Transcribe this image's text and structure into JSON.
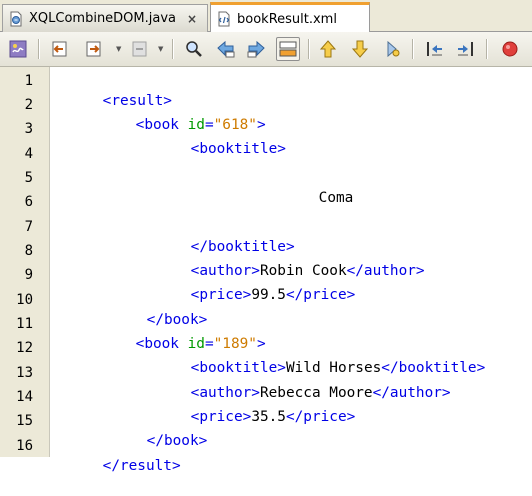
{
  "tabs": [
    {
      "label": "XQLCombineDOM.java",
      "icon": "java-file-icon",
      "close": "×",
      "active": false
    },
    {
      "label": "bookResult.xml",
      "icon": "xml-file-icon",
      "active": true
    }
  ],
  "toolbar": {
    "buttons": [
      "source-history-icon",
      "back-icon",
      "forward-icon",
      "disabled-icon",
      "find-icon",
      "find-previous-icon",
      "find-next-icon",
      "toggle-highlight-icon",
      "previous-bookmark-icon",
      "next-bookmark-icon",
      "toggle-bookmark-icon",
      "shift-left-icon",
      "shift-right-icon",
      "stop-macro-icon"
    ]
  },
  "editor": {
    "line_numbers": [
      "1",
      "2",
      "3",
      "4",
      "5",
      "6",
      "7",
      "8",
      "9",
      "10",
      "11",
      "12",
      "13",
      "14",
      "15",
      "16"
    ],
    "lines": [
      [
        {
          "t": "<result>",
          "c": "tag"
        }
      ],
      [
        {
          "t": "<book ",
          "c": "tag"
        },
        {
          "t": "id",
          "c": "attr"
        },
        {
          "t": "=",
          "c": "tag"
        },
        {
          "t": "\"618\"",
          "c": "val"
        },
        {
          "t": ">",
          "c": "tag"
        }
      ],
      [
        {
          "t": "<booktitle>",
          "c": "tag"
        }
      ],
      [],
      [
        {
          "t": "Coma",
          "c": "txt"
        }
      ],
      [],
      [
        {
          "t": "</booktitle>",
          "c": "tag"
        }
      ],
      [
        {
          "t": "<author>",
          "c": "tag"
        },
        {
          "t": "Robin Cook",
          "c": "txt"
        },
        {
          "t": "</author>",
          "c": "tag"
        }
      ],
      [
        {
          "t": "<price>",
          "c": "tag"
        },
        {
          "t": "99.5",
          "c": "txt"
        },
        {
          "t": "</price>",
          "c": "tag"
        }
      ],
      [
        {
          "t": "</book>",
          "c": "tag"
        }
      ],
      [
        {
          "t": "<book ",
          "c": "tag"
        },
        {
          "t": "id",
          "c": "attr"
        },
        {
          "t": "=",
          "c": "tag"
        },
        {
          "t": "\"189\"",
          "c": "val"
        },
        {
          "t": ">",
          "c": "tag"
        }
      ],
      [
        {
          "t": "<booktitle>",
          "c": "tag"
        },
        {
          "t": "Wild Horses",
          "c": "txt"
        },
        {
          "t": "</booktitle>",
          "c": "tag"
        }
      ],
      [
        {
          "t": "<author>",
          "c": "tag"
        },
        {
          "t": "Rebecca Moore",
          "c": "txt"
        },
        {
          "t": "</author>",
          "c": "tag"
        }
      ],
      [
        {
          "t": "<price>",
          "c": "tag"
        },
        {
          "t": "35.5",
          "c": "txt"
        },
        {
          "t": "</price>",
          "c": "tag"
        }
      ],
      [
        {
          "t": "</book>",
          "c": "tag"
        }
      ],
      [
        {
          "t": "</result>",
          "c": "tag"
        }
      ]
    ]
  }
}
